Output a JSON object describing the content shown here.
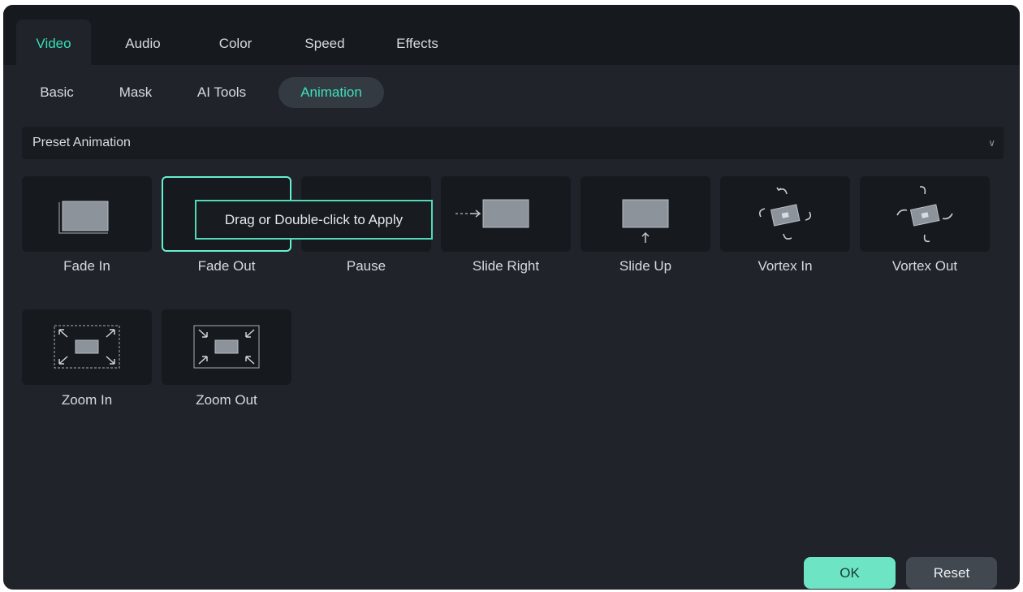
{
  "tabs": [
    "Video",
    "Audio",
    "Color",
    "Speed",
    "Effects"
  ],
  "active_tab": "Video",
  "subtabs": [
    "Basic",
    "Mask",
    "AI Tools",
    "Animation"
  ],
  "active_subtab": "Animation",
  "preset": {
    "label": "Preset Animation",
    "chevron_icon": "chevron-down-icon"
  },
  "animations": [
    {
      "label": "Fade In",
      "icon": "fade-in-icon"
    },
    {
      "label": "Fade Out",
      "icon": "fade-out-icon"
    },
    {
      "label": "Pause",
      "icon": "pause-icon"
    },
    {
      "label": "Slide Right",
      "icon": "slide-right-icon"
    },
    {
      "label": "Slide Up",
      "icon": "slide-up-icon"
    },
    {
      "label": "Vortex In",
      "icon": "vortex-in-icon"
    },
    {
      "label": "Vortex Out",
      "icon": "vortex-out-icon"
    },
    {
      "label": "Zoom In",
      "icon": "zoom-in-icon"
    },
    {
      "label": "Zoom Out",
      "icon": "zoom-out-icon"
    }
  ],
  "selected_animation": "Fade Out",
  "tooltip": "Drag or Double-click to Apply",
  "buttons": {
    "ok": "OK",
    "reset": "Reset"
  },
  "colors": {
    "accent": "#35dfb7",
    "panel": "#202329",
    "tile": "#16191d",
    "ok_button": "#6de5c5"
  }
}
